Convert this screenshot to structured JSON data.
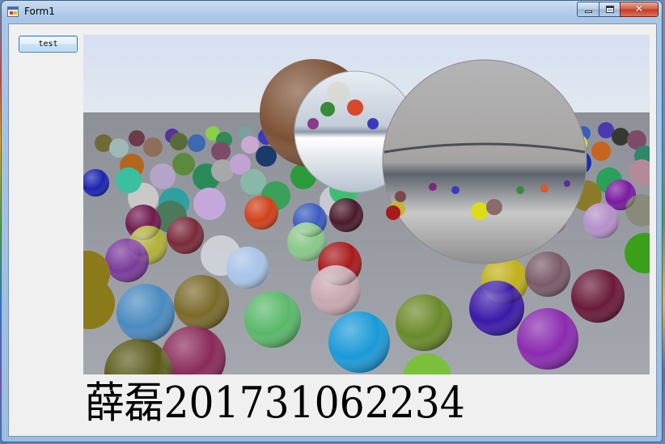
{
  "window": {
    "title": "Form1",
    "app_icon": "form-window-icon",
    "controls": {
      "minimize_icon": "minimize-icon",
      "maximize_icon": "maximize-icon",
      "close_icon": "close-icon",
      "close_glyph": "✕"
    }
  },
  "toolbar": {
    "test_label": "test"
  },
  "render": {
    "description_icon": "rendered-spheres-image",
    "colors": {
      "sky": "#d5e0f2",
      "ground": "#9ea3aa",
      "brown_sphere": "#7d5236",
      "metal_sphere": "#a8a8a8"
    }
  },
  "label": {
    "text": "薛磊201731062234"
  }
}
